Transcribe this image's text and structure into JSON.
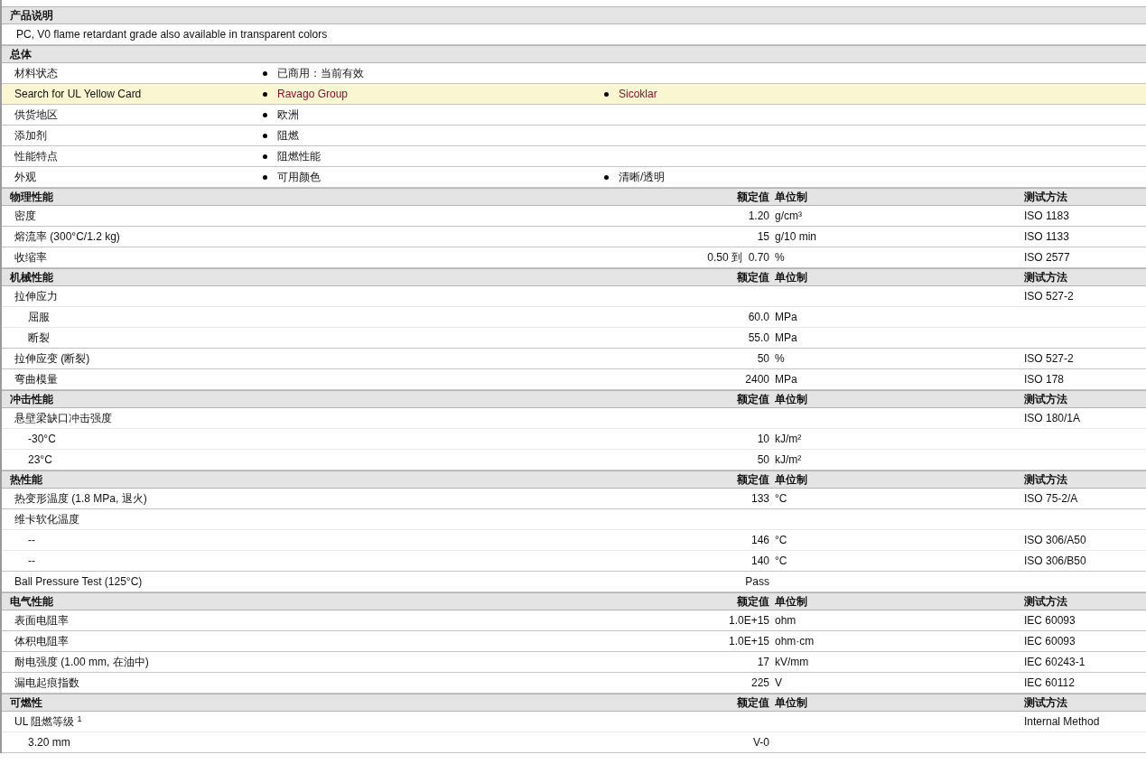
{
  "sections": [
    {
      "title": "产品说明",
      "rows": [
        {
          "kind": "text",
          "text": "PC, V0 flame retardant grade also available in transparent colors"
        }
      ]
    },
    {
      "title": "总体",
      "rows": [
        {
          "kind": "bullets",
          "label": "材料状态",
          "items": [
            "已商用：当前有效"
          ]
        },
        {
          "kind": "links",
          "label": "Search for UL Yellow Card",
          "items": [
            "Ravago Group",
            "Sicoklar"
          ]
        },
        {
          "kind": "bullets",
          "label": "供货地区",
          "items": [
            "欧洲"
          ]
        },
        {
          "kind": "bullets",
          "label": "添加剂",
          "items": [
            "阻燃"
          ]
        },
        {
          "kind": "bullets",
          "label": "性能特点",
          "items": [
            "阻燃性能"
          ]
        },
        {
          "kind": "bullets",
          "label": "外观",
          "items": [
            "可用颜色",
            "清晰/透明"
          ]
        }
      ]
    },
    {
      "title": "物理性能",
      "headers": [
        "额定值",
        "单位制",
        "测试方法"
      ],
      "rows": [
        {
          "kind": "property",
          "label": "密度",
          "value": "1.20",
          "unit": "g/cm³",
          "method": "ISO 1183"
        },
        {
          "kind": "property",
          "label": "熔流率  (300°C/1.2 kg)",
          "value": "15",
          "unit": "g/10 min",
          "method": "ISO 1133"
        },
        {
          "kind": "property",
          "label": "收缩率",
          "value": "0.50 到  0.70",
          "unit": "%",
          "method": "ISO 2577"
        }
      ]
    },
    {
      "title": "机械性能",
      "headers": [
        "额定值",
        "单位制",
        "测试方法"
      ],
      "rows": [
        {
          "kind": "property",
          "label": "拉伸应力",
          "method": "ISO 527-2",
          "children": [
            {
              "label": "屈服",
              "value": "60.0",
              "unit": "MPa"
            },
            {
              "label": "断裂",
              "value": "55.0",
              "unit": "MPa"
            }
          ]
        },
        {
          "kind": "property",
          "label": "拉伸应变  (断裂)",
          "value": "50",
          "unit": "%",
          "method": "ISO 527-2"
        },
        {
          "kind": "property",
          "label": "弯曲模量",
          "value": "2400",
          "unit": "MPa",
          "method": "ISO 178"
        }
      ]
    },
    {
      "title": "冲击性能",
      "headers": [
        "额定值",
        "单位制",
        "测试方法"
      ],
      "rows": [
        {
          "kind": "property",
          "label": "悬壁梁缺口冲击强度",
          "method": "ISO 180/1A",
          "children": [
            {
              "label": "-30°C",
              "value": "10",
              "unit": "kJ/m²"
            },
            {
              "label": "23°C",
              "value": "50",
              "unit": "kJ/m²"
            }
          ]
        }
      ]
    },
    {
      "title": "热性能",
      "headers": [
        "额定值",
        "单位制",
        "测试方法"
      ],
      "rows": [
        {
          "kind": "property",
          "label": "热变形温度  (1.8 MPa, 退火)",
          "value": "133",
          "unit": "°C",
          "method": "ISO 75-2/A"
        },
        {
          "kind": "property",
          "label": "维卡软化温度",
          "children": [
            {
              "label": "--",
              "value": "146",
              "unit": "°C",
              "method": "ISO 306/A50"
            },
            {
              "label": "--",
              "value": "140",
              "unit": "°C",
              "method": "ISO 306/B50"
            }
          ]
        },
        {
          "kind": "property",
          "label": "Ball Pressure Test (125°C)",
          "value": "Pass"
        }
      ]
    },
    {
      "title": "电气性能",
      "headers": [
        "额定值",
        "单位制",
        "测试方法"
      ],
      "rows": [
        {
          "kind": "property",
          "label": "表面电阻率",
          "value": "1.0E+15",
          "unit": "ohm",
          "method": "IEC 60093"
        },
        {
          "kind": "property",
          "label": "体积电阻率",
          "value": "1.0E+15",
          "unit": "ohm·cm",
          "method": "IEC 60093"
        },
        {
          "kind": "property",
          "label": "耐电强度  (1.00 mm, 在油中)",
          "value": "17",
          "unit": "kV/mm",
          "method": "IEC 60243-1"
        },
        {
          "kind": "property",
          "label": "漏电起痕指数",
          "value": "225",
          "unit": "V",
          "method": "IEC 60112"
        }
      ]
    },
    {
      "title": "可燃性",
      "headers": [
        "额定值",
        "单位制",
        "测试方法"
      ],
      "rows": [
        {
          "kind": "property",
          "label": "UL 阻燃等级 $^{1}$",
          "method": "Internal Method",
          "children": [
            {
              "label": "3.20 mm",
              "value": "V-0"
            }
          ]
        }
      ]
    }
  ]
}
